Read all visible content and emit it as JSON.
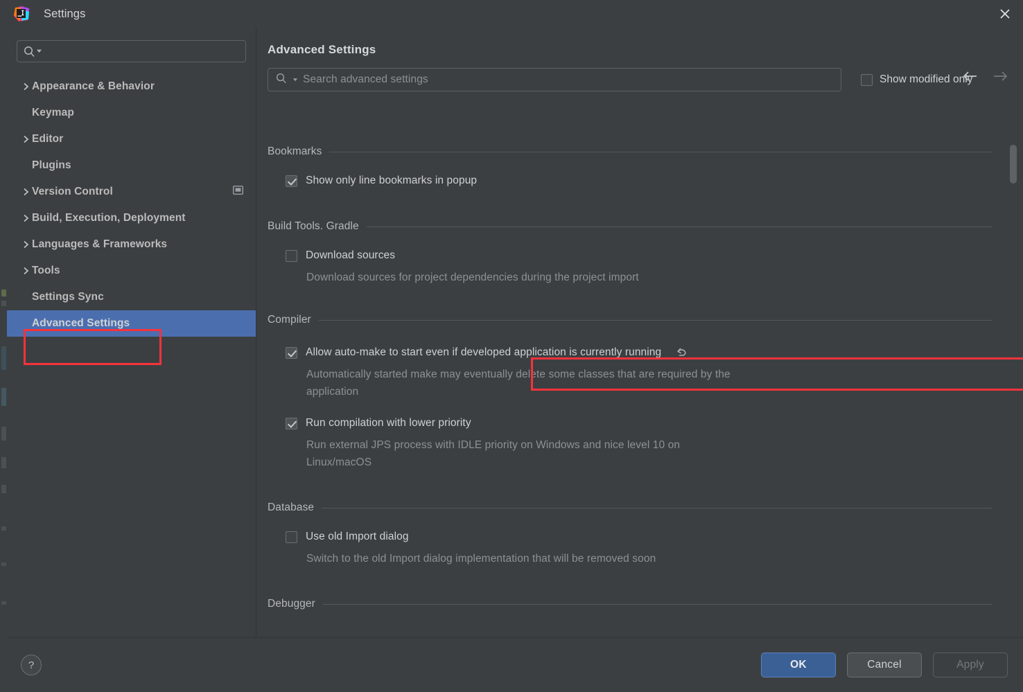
{
  "window": {
    "title": "Settings",
    "app_icon": "intellij-idea-logo",
    "close_icon": "close-icon"
  },
  "sidebar": {
    "search": {
      "placeholder": "",
      "value": "",
      "icon": "search-icon"
    },
    "items": [
      {
        "label": "Appearance & Behavior",
        "expandable": true,
        "selected": false,
        "scope_icon": false
      },
      {
        "label": "Keymap",
        "expandable": false,
        "selected": false,
        "scope_icon": false
      },
      {
        "label": "Editor",
        "expandable": true,
        "selected": false,
        "scope_icon": false
      },
      {
        "label": "Plugins",
        "expandable": false,
        "selected": false,
        "scope_icon": false
      },
      {
        "label": "Version Control",
        "expandable": true,
        "selected": false,
        "scope_icon": true
      },
      {
        "label": "Build, Execution, Deployment",
        "expandable": true,
        "selected": false,
        "scope_icon": false
      },
      {
        "label": "Languages & Frameworks",
        "expandable": true,
        "selected": false,
        "scope_icon": false
      },
      {
        "label": "Tools",
        "expandable": true,
        "selected": false,
        "scope_icon": false
      },
      {
        "label": "Settings Sync",
        "expandable": false,
        "selected": false,
        "scope_icon": false
      },
      {
        "label": "Advanced Settings",
        "expandable": false,
        "selected": true,
        "scope_icon": false
      }
    ]
  },
  "header": {
    "title": "Advanced Settings",
    "back_icon": "arrow-left-icon",
    "forward_icon": "arrow-right-icon",
    "search": {
      "placeholder": "Search advanced settings",
      "value": "",
      "icon": "search-icon"
    },
    "show_modified_only": {
      "label": "Show modified only",
      "checked": false
    }
  },
  "groups": [
    {
      "name": "Bookmarks",
      "options": [
        {
          "label": "Show only line bookmarks in popup",
          "checked": true,
          "description": "",
          "revert": false,
          "highlighted": false
        }
      ]
    },
    {
      "name": "Build Tools. Gradle",
      "options": [
        {
          "label": "Download sources",
          "checked": false,
          "description": "Download sources for project dependencies during the project import",
          "revert": false,
          "highlighted": false
        }
      ]
    },
    {
      "name": "Compiler",
      "options": [
        {
          "label": "Allow auto-make to start even if developed application is currently running",
          "checked": true,
          "description": "Automatically started make may eventually delete some classes that are required by the application",
          "revert": true,
          "revert_icon": "revert-icon",
          "highlighted": true
        },
        {
          "label": "Run compilation with lower priority",
          "checked": true,
          "description": "Run external JPS process with IDLE priority on Windows and nice level 10 on Linux/macOS",
          "revert": false,
          "highlighted": false
        }
      ]
    },
    {
      "name": "Database",
      "options": [
        {
          "label": "Use old Import dialog",
          "checked": false,
          "description": "Switch to the old Import dialog implementation that will be removed soon",
          "revert": false,
          "highlighted": false
        }
      ]
    },
    {
      "name": "Debugger",
      "options": []
    }
  ],
  "footer": {
    "help_label": "?",
    "ok_label": "OK",
    "cancel_label": "Cancel",
    "apply_label": "Apply",
    "apply_disabled": true
  },
  "colors": {
    "accent_selection": "#4b6eaf",
    "annotation_red": "#f8323c",
    "primary_button": "#3b6096",
    "panel_bg": "#3c3f41"
  }
}
